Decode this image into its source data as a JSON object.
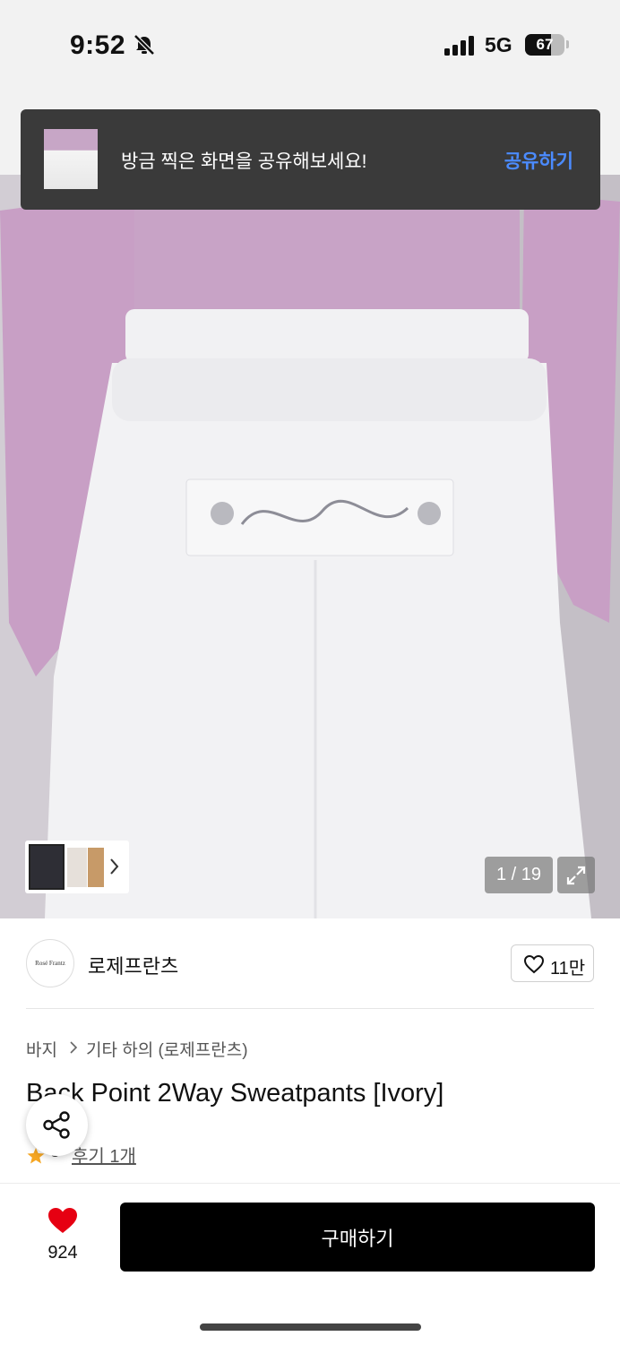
{
  "status_bar": {
    "time": "9:52",
    "network": "5G",
    "battery": "67",
    "battery_level": 0.67
  },
  "toast": {
    "message": "방금 찍은 화면을 공유해보세요!",
    "action": "공유하기"
  },
  "gallery": {
    "counter": "1 / 19",
    "current": 1,
    "total": 19
  },
  "brand": {
    "logo_text": "Rosé Frantz",
    "name": "로제프란츠",
    "likes": "11만"
  },
  "breadcrumb": {
    "category": "바지",
    "subcategory": "기타 하의 (로제프란츠)"
  },
  "product": {
    "title": "Back Point 2Way Sweatpants [Ivory]",
    "rating": "5",
    "review_link": "후기 1개"
  },
  "bottom_bar": {
    "wish_count": "924",
    "buy_label": "구매하기"
  },
  "colors": {
    "toast_bg": "#3a3a3a",
    "toast_action": "#4b8bff",
    "heart": "#e60012",
    "buy_button": "#000000",
    "star": "#f5a623"
  },
  "icons": [
    "bell-slash-icon",
    "signal-icon",
    "battery-icon",
    "chevron-right-icon",
    "expand-icon",
    "heart-outline-icon",
    "share-icon",
    "star-icon",
    "heart-filled-icon"
  ]
}
